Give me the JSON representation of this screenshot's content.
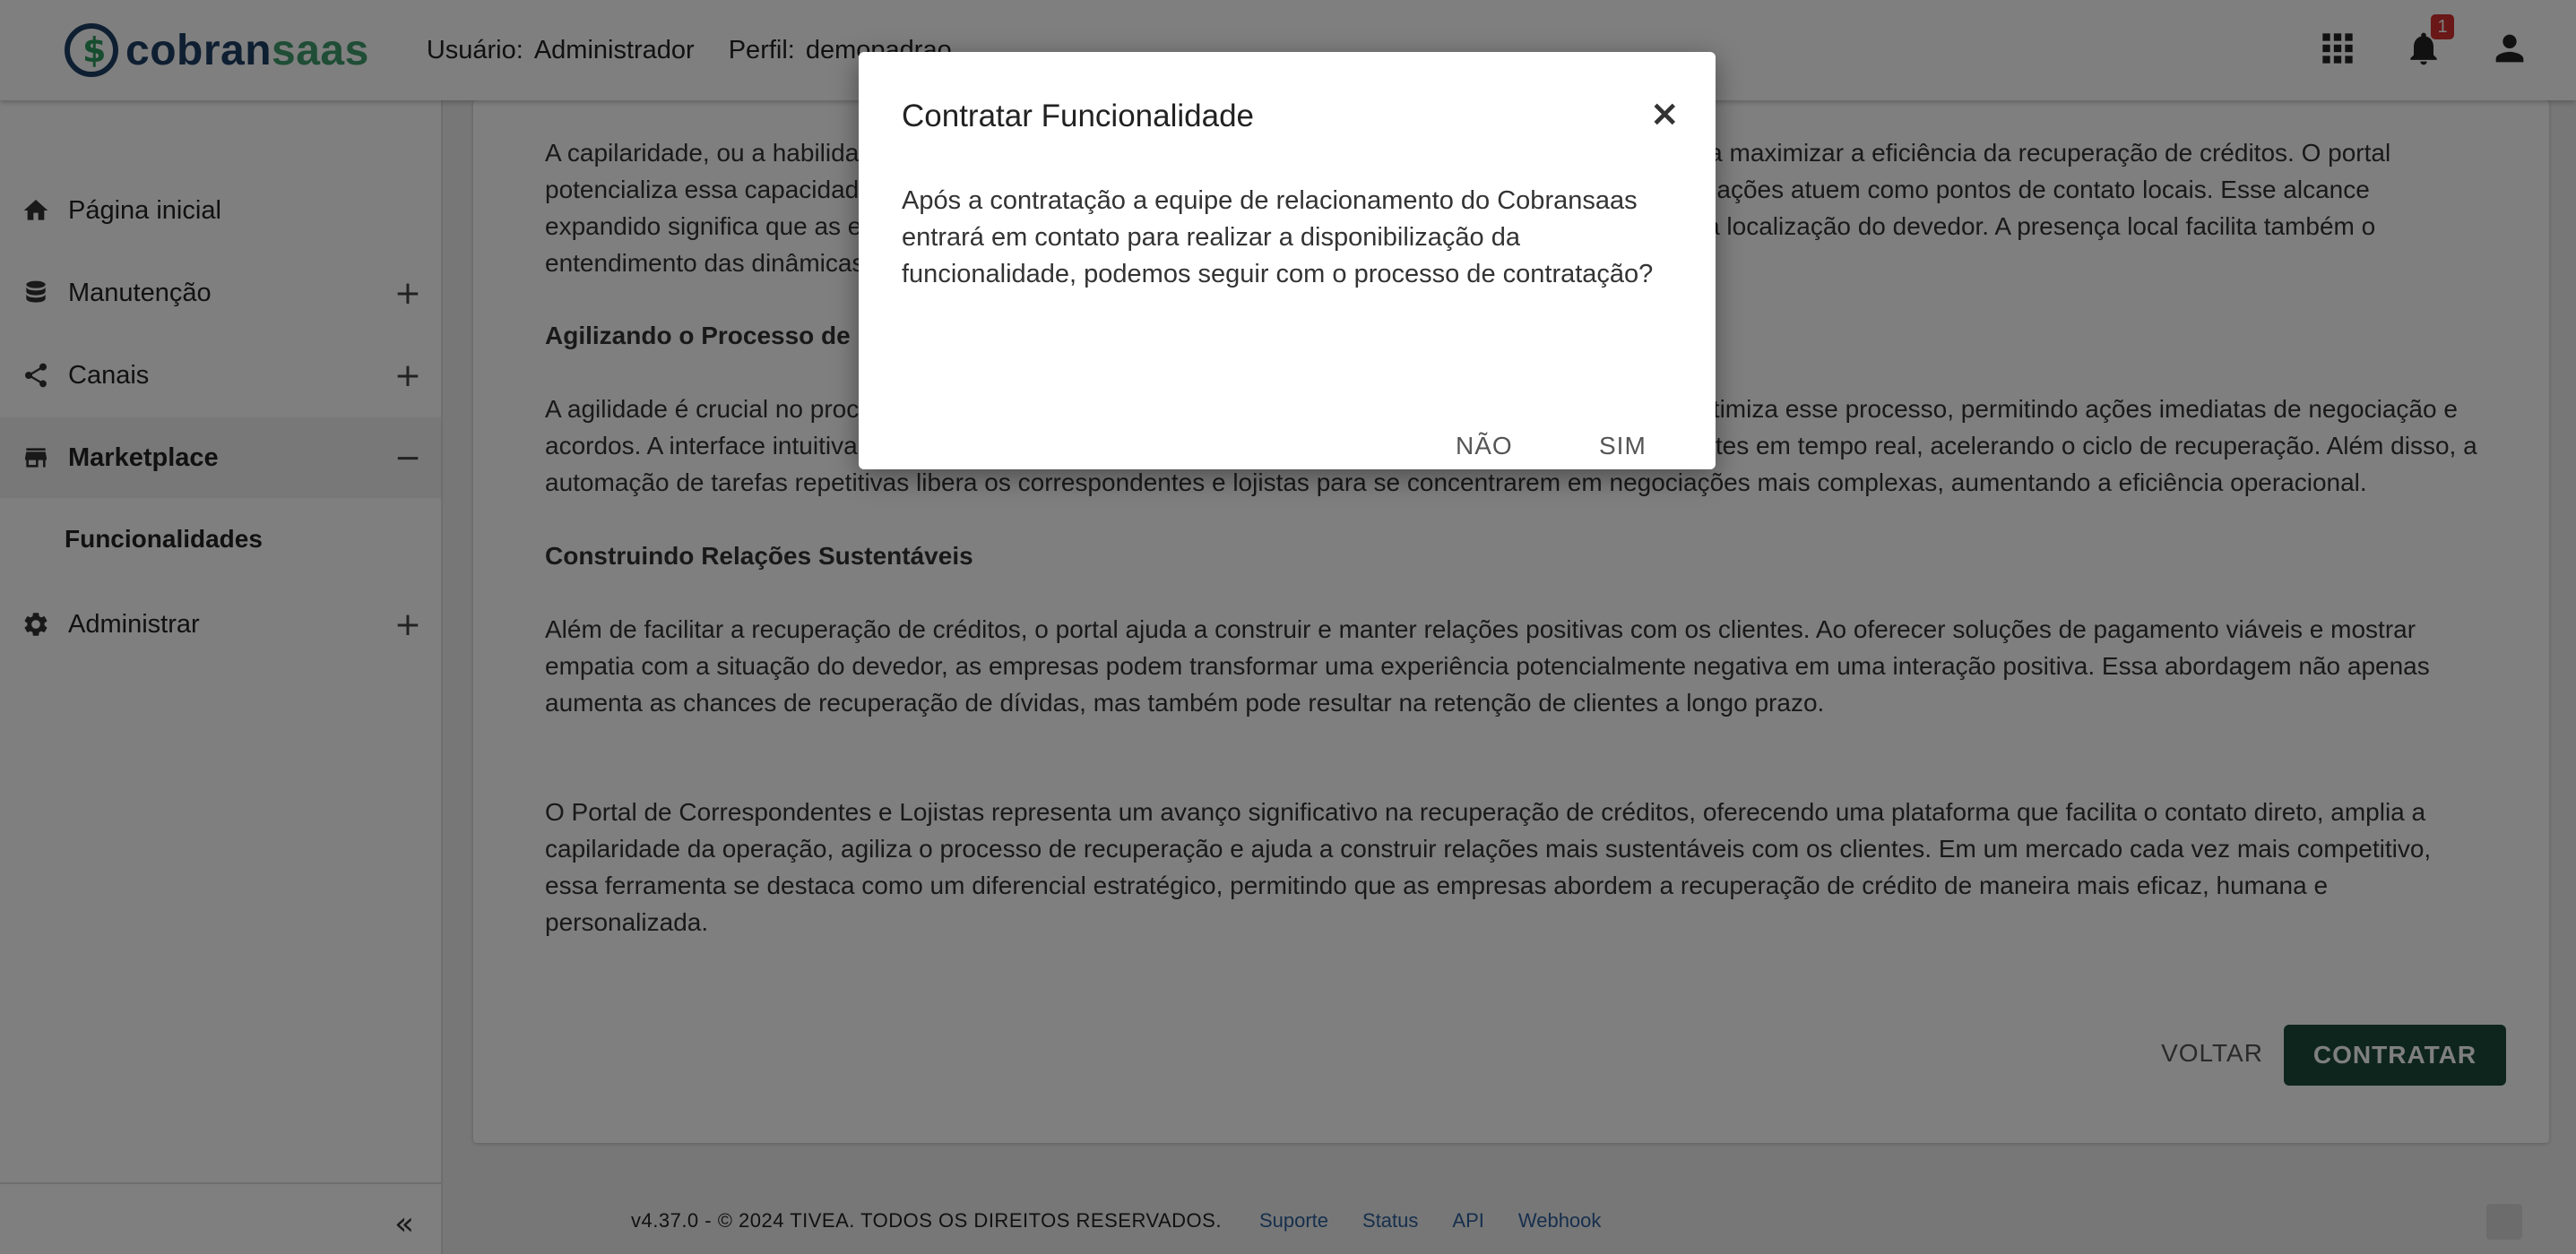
{
  "header": {
    "logo_part1": "cobran",
    "logo_part2": "saas",
    "user_label": "Usuário:",
    "user_value": "Administrador",
    "profile_label": "Perfil:",
    "profile_value": "demopadrao",
    "notification_count": "1"
  },
  "sidebar": {
    "items": [
      {
        "label": "Página inicial",
        "icon": "home-icon"
      },
      {
        "label": "Manutenção",
        "icon": "database-icon",
        "toggle": "+"
      },
      {
        "label": "Canais",
        "icon": "share-icon",
        "toggle": "+"
      },
      {
        "label": "Marketplace",
        "icon": "store-icon",
        "toggle": "−"
      },
      {
        "label": "Administrar",
        "icon": "gear-icon",
        "toggle": "+"
      }
    ],
    "sub_item": "Funcionalidades",
    "collapse_glyph": "«"
  },
  "content": {
    "p1": "A capilaridade, ou a habilidade de se espalhar por diversas regiões, é um dos pontos fortes do portal para maximizar a eficiência da recuperação de créditos. O portal potencializa essa capacidade ao permitir que correspondentes e lojistas distribuídos em diferentes localizações atuem como pontos de contato locais. Esse alcance expandido significa que as empresas podem oferecer atendimento personalizado, independentemente da localização do devedor. A presença local facilita também o entendimento das dinâmicas regionais.",
    "h1": "Agilizando o Processo de Recuperação",
    "p2": "A agilidade é crucial no processo de recuperação de créditos, e o Portal de Correspondentes e Lojistas otimiza esse processo, permitindo ações imediatas de negociação e acordos. A interface intuitiva facilita o registro das negociações e a atualização das informações dos clientes em tempo real, acelerando o ciclo de recuperação. Além disso, a automação de tarefas repetitivas libera os correspondentes e lojistas para se concentrarem em negociações mais complexas, aumentando a eficiência operacional.",
    "h2": "Construindo Relações Sustentáveis",
    "p3": "Além de facilitar a recuperação de créditos, o portal ajuda a construir e manter relações positivas com os clientes. Ao oferecer soluções de pagamento viáveis e mostrar empatia com a situação do devedor, as empresas podem transformar uma experiência potencialmente negativa em uma interação positiva. Essa abordagem não apenas aumenta as chances de recuperação de dívidas, mas também pode resultar na retenção de clientes a longo prazo.",
    "p4": "O Portal de Correspondentes e Lojistas representa um avanço significativo na recuperação de créditos, oferecendo uma plataforma que facilita o contato direto, amplia a capilaridade da operação, agiliza o processo de recuperação e ajuda a construir relações mais sustentáveis com os clientes. Em um mercado cada vez mais competitivo, essa ferramenta se destaca como um diferencial estratégico, permitindo que as empresas abordem a recuperação de crédito de maneira mais eficaz, humana e personalizada.",
    "back_label": "VOLTAR",
    "contract_label": "CONTRATAR"
  },
  "footer": {
    "copyright": "v4.37.0 - © 2024 TIVEA. TODOS OS DIREITOS RESERVADOS.",
    "links": [
      "Suporte",
      "Status",
      "API",
      "Webhook"
    ]
  },
  "modal": {
    "title": "Contratar Funcionalidade",
    "close_glyph": "×",
    "body": "Após a contratação a equipe de relacionamento do Cobransaas entrará em contato para realizar a disponibilização da funcionalidade, podemos seguir com o processo de contratação?",
    "no_label": "NÃO",
    "yes_label": "SIM"
  },
  "colors": {
    "primary_button": "#1c4a3a",
    "logo_dark": "#1e3f64",
    "logo_green": "#3f9a6a",
    "badge": "#d32f2f",
    "link": "#2d5f9a"
  }
}
